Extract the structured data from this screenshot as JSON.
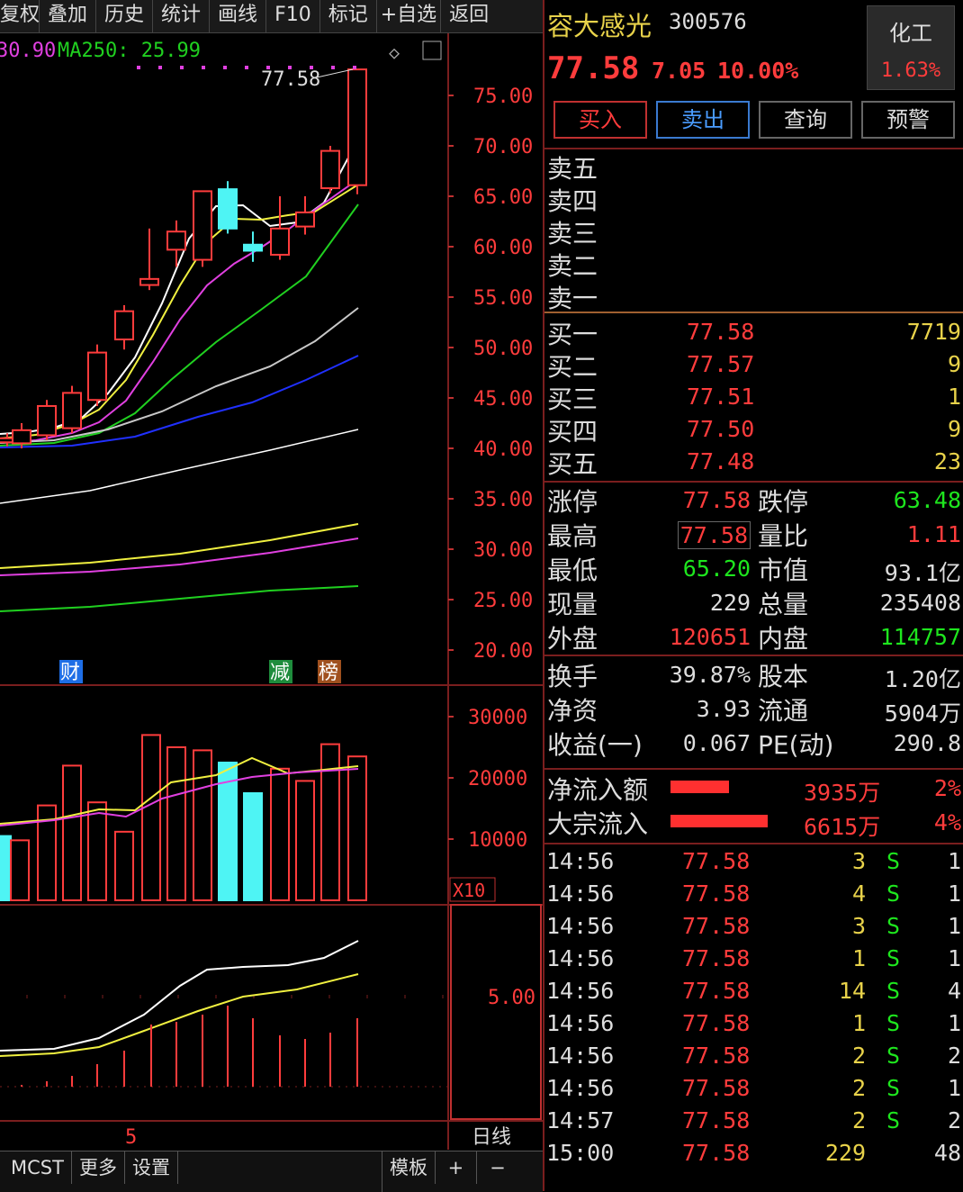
{
  "toolbar": [
    "复权",
    "叠加",
    "历史",
    "统计",
    "画线",
    "F10",
    "标记",
    "+自选",
    "返回"
  ],
  "chart": {
    "ma_partial": "30.90",
    "ma250": "MA250: 25.99",
    "peak_label": "77.58",
    "price_ticks": [
      "75.00",
      "70.00",
      "65.00",
      "60.00",
      "55.00",
      "50.00",
      "45.00",
      "40.00",
      "35.00",
      "30.00",
      "25.00",
      "20.00"
    ],
    "markers": [
      {
        "text": "财",
        "color": "#1e6ee6"
      },
      {
        "text": "减",
        "color": "#1e8c3c"
      },
      {
        "text": "榜",
        "color": "#a0501e"
      }
    ],
    "vol_ticks": [
      "30000",
      "20000",
      "10000"
    ],
    "vol_unit": "X10",
    "ind_tick": "5.00",
    "month_label": "5",
    "period": "日线",
    "colors": {
      "up": "#ff3c3c",
      "down": "#4ef4f4",
      "ma5": "#ffffff",
      "ma10": "#f0f040",
      "ma20": "#e040e0",
      "ma30": "#20d020",
      "ma60": "#c8c8c8",
      "ma120": "#2030ff"
    }
  },
  "bottombar": {
    "mcst": "MCST",
    "more": "更多",
    "settings": "设置",
    "template": "模板",
    "plus": "+",
    "minus": "−"
  },
  "stock": {
    "name": "容大感光",
    "code": "300576",
    "sector": "化工",
    "sector_pct": "1.63%",
    "price": "77.58",
    "change": "7.05",
    "change_pct": "10.00%"
  },
  "actions": {
    "buy": "买入",
    "sell": "卖出",
    "query": "查询",
    "alert": "预警"
  },
  "sell_levels": [
    "卖五",
    "卖四",
    "卖三",
    "卖二",
    "卖一"
  ],
  "buy_levels": [
    {
      "label": "买一",
      "price": "77.58",
      "vol": "7719"
    },
    {
      "label": "买二",
      "price": "77.57",
      "vol": "9"
    },
    {
      "label": "买三",
      "price": "77.51",
      "vol": "1"
    },
    {
      "label": "买四",
      "price": "77.50",
      "vol": "9"
    },
    {
      "label": "买五",
      "price": "77.48",
      "vol": "23"
    }
  ],
  "stats": [
    {
      "l1": "涨停",
      "v1": "77.58",
      "c1": "red",
      "l2": "跌停",
      "v2": "63.48",
      "c2": "green"
    },
    {
      "l1": "最高",
      "v1": "77.58",
      "c1": "red",
      "l2": "量比",
      "v2": "1.11",
      "c2": "red"
    },
    {
      "l1": "最低",
      "v1": "65.20",
      "c1": "green",
      "l2": "市值",
      "v2": "93.1亿",
      "c2": "white"
    },
    {
      "l1": "现量",
      "v1": "229",
      "c1": "white",
      "l2": "总量",
      "v2": "235408",
      "c2": "white"
    },
    {
      "l1": "外盘",
      "v1": "120651",
      "c1": "red",
      "l2": "内盘",
      "v2": "114757",
      "c2": "green"
    }
  ],
  "stats2": [
    {
      "l1": "换手",
      "v1": "39.87%",
      "l2": "股本",
      "v2": "1.20亿"
    },
    {
      "l1": "净资",
      "v1": "3.93",
      "l2": "流通",
      "v2": "5904万"
    },
    {
      "l1": "收益(一)",
      "v1": "0.067",
      "l2": "PE(动)",
      "v2": "290.8"
    }
  ],
  "flows": [
    {
      "label": "净流入额",
      "value": "3935万",
      "pct": "2%",
      "bar": 0.6
    },
    {
      "label": "大宗流入",
      "value": "6615万",
      "pct": "4%",
      "bar": 1.0
    }
  ],
  "ticks": [
    {
      "time": "14:56",
      "price": "77.58",
      "vol": "3",
      "side": "S",
      "n": "1"
    },
    {
      "time": "14:56",
      "price": "77.58",
      "vol": "4",
      "side": "S",
      "n": "1"
    },
    {
      "time": "14:56",
      "price": "77.58",
      "vol": "3",
      "side": "S",
      "n": "1"
    },
    {
      "time": "14:56",
      "price": "77.58",
      "vol": "1",
      "side": "S",
      "n": "1"
    },
    {
      "time": "14:56",
      "price": "77.58",
      "vol": "14",
      "side": "S",
      "n": "4"
    },
    {
      "time": "14:56",
      "price": "77.58",
      "vol": "1",
      "side": "S",
      "n": "1"
    },
    {
      "time": "14:56",
      "price": "77.58",
      "vol": "2",
      "side": "S",
      "n": "2"
    },
    {
      "time": "14:56",
      "price": "77.58",
      "vol": "2",
      "side": "S",
      "n": "1"
    },
    {
      "time": "14:57",
      "price": "77.58",
      "vol": "2",
      "side": "S",
      "n": "2"
    },
    {
      "time": "15:00",
      "price": "77.58",
      "vol": "229",
      "side": "",
      "n": "48"
    }
  ]
}
